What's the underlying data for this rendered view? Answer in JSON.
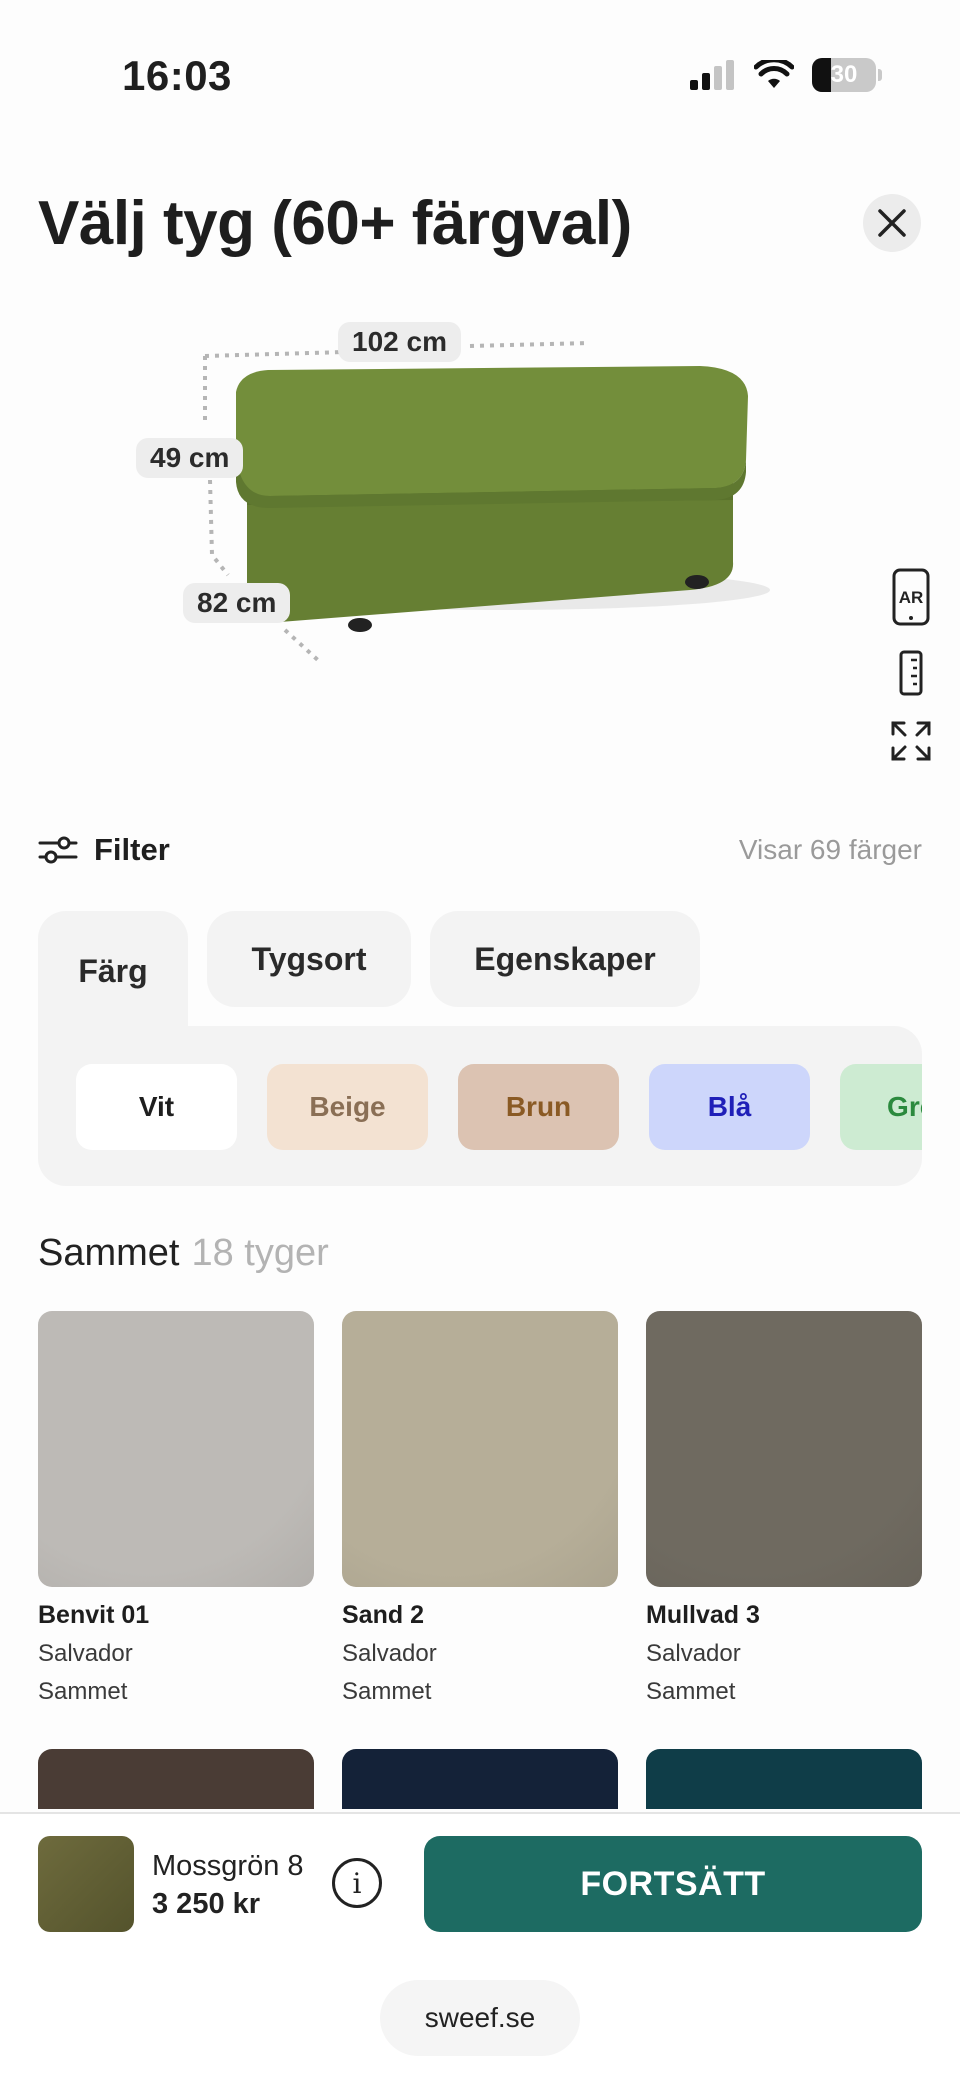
{
  "status": {
    "time": "16:03",
    "battery": "30"
  },
  "header": {
    "title": "Välj tyg (60+ färgval)"
  },
  "product": {
    "width_label": "102 cm",
    "height_label": "49 cm",
    "depth_label": "82 cm",
    "color": "#6f8a3a",
    "tools": {
      "ar_label": "AR"
    }
  },
  "filter": {
    "label": "Filter",
    "count_text": "Visar 69 färger"
  },
  "tabs": [
    {
      "label": "Färg"
    },
    {
      "label": "Tygsort"
    },
    {
      "label": "Egenskaper"
    }
  ],
  "color_chips": [
    {
      "label": "Vit",
      "bg": "#ffffff",
      "fg": "#1e1e1e"
    },
    {
      "label": "Beige",
      "bg": "#f3e2d2",
      "fg": "#8a6f55"
    },
    {
      "label": "Brun",
      "bg": "#dcc3b2",
      "fg": "#8a5a24"
    },
    {
      "label": "Blå",
      "bg": "#cdd6fb",
      "fg": "#1f1fb8"
    },
    {
      "label": "Grön",
      "bg": "#cdebd2",
      "fg": "#2b8a3e"
    }
  ],
  "section": {
    "title": "Sammet",
    "subtitle": "18 tyger"
  },
  "fabrics": [
    {
      "name": "Benvit 01",
      "line1": "Salvador",
      "line2": "Sammet",
      "color": "#bdbab6"
    },
    {
      "name": "Sand 2",
      "line1": "Salvador",
      "line2": "Sammet",
      "color": "#b6ae98"
    },
    {
      "name": "Mullvad 3",
      "line1": "Salvador",
      "line2": "Sammet",
      "color": "#6f6a60"
    }
  ],
  "fabrics_row2_colors": [
    "#4a3c35",
    "#142238",
    "#0f3d48"
  ],
  "selection": {
    "name": "Mossgrön 8",
    "price": "3 250 kr",
    "info_label": "i"
  },
  "cta": {
    "label": "FORTSÄTT"
  },
  "footer": {
    "url": "sweef.se"
  }
}
